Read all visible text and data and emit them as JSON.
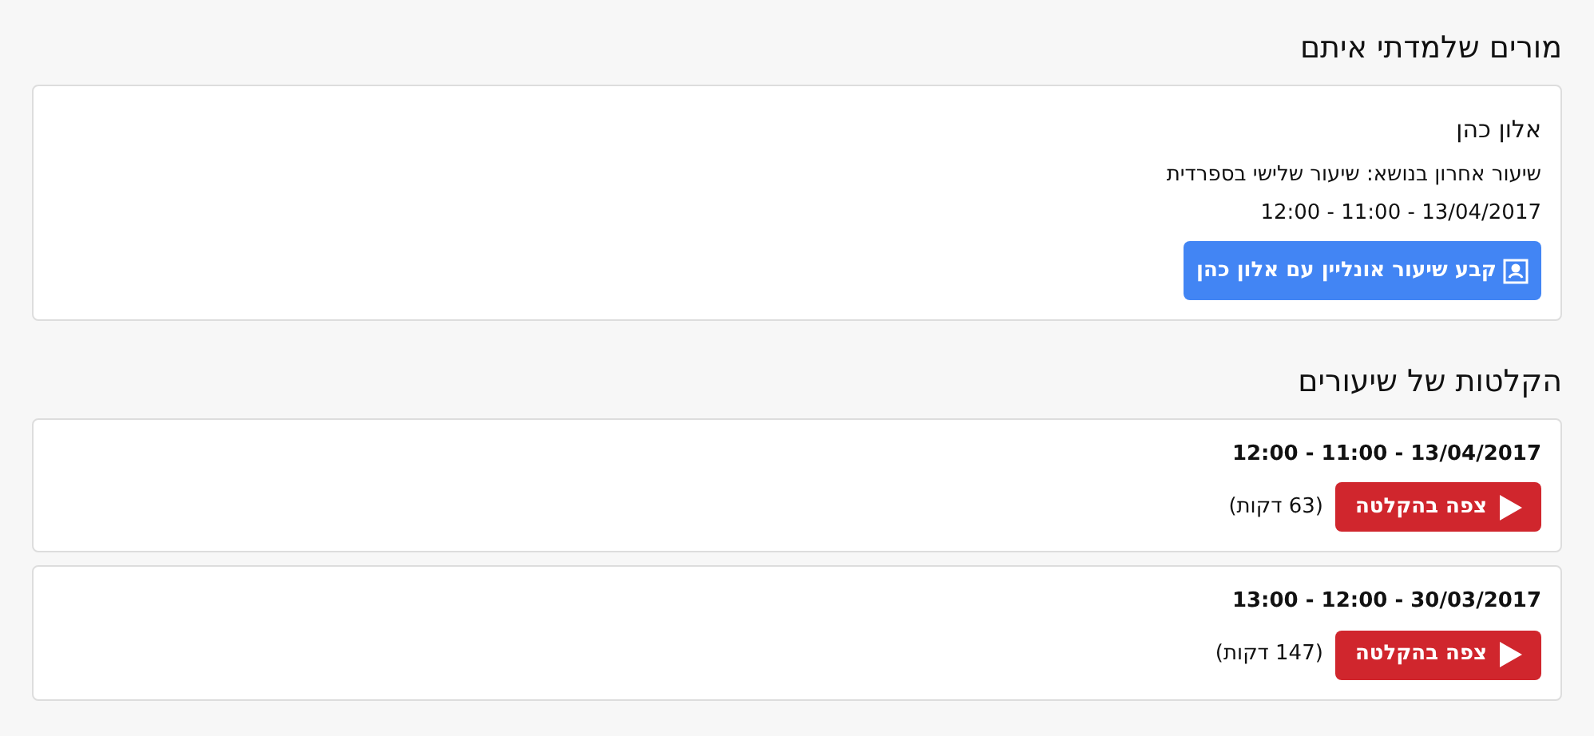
{
  "teachers_section": {
    "title": "מורים שלמדתי איתם",
    "teachers": [
      {
        "name": "אלון כהן",
        "last_lesson": "שיעור אחרון בנושא: שיעור שלישי בספרדית",
        "time": "13/04/2017 - 11:00 - 12:00",
        "button": "קבע שיעור אונליין עם אלון כהן"
      }
    ]
  },
  "recordings_section": {
    "title": "הקלטות של שיעורים",
    "recordings": [
      {
        "time": "13/04/2017 - 11:00 - 12:00",
        "button": "צפה בהקלטה",
        "duration": "(63 דקות)"
      },
      {
        "time": "30/03/2017 - 12:00 - 13:00",
        "button": "צפה בהקלטה",
        "duration": "(147 דקות)"
      }
    ]
  }
}
